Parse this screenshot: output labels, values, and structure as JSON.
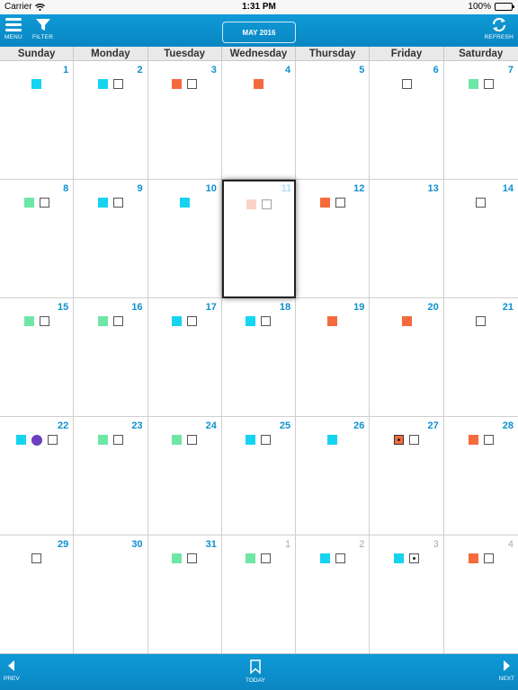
{
  "status_bar": {
    "carrier": "Carrier",
    "time": "1:31 PM",
    "battery": "100%"
  },
  "header": {
    "menu_label": "MENU",
    "filter_label": "FILTER",
    "month_label": "MAY 2016",
    "refresh_label": "REFRESH"
  },
  "weekdays": [
    "Sunday",
    "Monday",
    "Tuesday",
    "Wednesday",
    "Thursday",
    "Friday",
    "Saturday"
  ],
  "colors": {
    "cyan": "#16d4f0",
    "green": "#6ee6a6",
    "orange": "#f56a3d",
    "peach": "#f7b09a",
    "purple": "#6b3fc0",
    "accent": "#0d90cf"
  },
  "calendar": {
    "today_day": 11,
    "days": [
      {
        "day": "1",
        "month": "current",
        "marks": [
          "cyan"
        ]
      },
      {
        "day": "2",
        "month": "current",
        "marks": [
          "cyan",
          "box"
        ]
      },
      {
        "day": "3",
        "month": "current",
        "marks": [
          "orange",
          "box"
        ]
      },
      {
        "day": "4",
        "month": "current",
        "marks": [
          "orange"
        ]
      },
      {
        "day": "5",
        "month": "current",
        "marks": []
      },
      {
        "day": "6",
        "month": "current",
        "marks": [
          "box"
        ]
      },
      {
        "day": "7",
        "month": "current",
        "marks": [
          "green",
          "box"
        ]
      },
      {
        "day": "8",
        "month": "current",
        "marks": [
          "green",
          "box"
        ]
      },
      {
        "day": "9",
        "month": "current",
        "marks": [
          "cyan",
          "box"
        ]
      },
      {
        "day": "10",
        "month": "current",
        "marks": [
          "cyan"
        ]
      },
      {
        "day": "11",
        "month": "current",
        "marks": [
          "peach",
          "box"
        ],
        "today": true
      },
      {
        "day": "12",
        "month": "current",
        "marks": [
          "orange",
          "box"
        ]
      },
      {
        "day": "13",
        "month": "current",
        "marks": []
      },
      {
        "day": "14",
        "month": "current",
        "marks": [
          "box"
        ]
      },
      {
        "day": "15",
        "month": "current",
        "marks": [
          "green",
          "box"
        ]
      },
      {
        "day": "16",
        "month": "current",
        "marks": [
          "green",
          "box"
        ]
      },
      {
        "day": "17",
        "month": "current",
        "marks": [
          "cyan",
          "box"
        ]
      },
      {
        "day": "18",
        "month": "current",
        "marks": [
          "cyan",
          "box"
        ]
      },
      {
        "day": "19",
        "month": "current",
        "marks": [
          "orange"
        ]
      },
      {
        "day": "20",
        "month": "current",
        "marks": [
          "orange"
        ]
      },
      {
        "day": "21",
        "month": "current",
        "marks": [
          "box"
        ]
      },
      {
        "day": "22",
        "month": "current",
        "marks": [
          "cyan",
          "purple-circle",
          "box"
        ]
      },
      {
        "day": "23",
        "month": "current",
        "marks": [
          "green",
          "box"
        ]
      },
      {
        "day": "24",
        "month": "current",
        "marks": [
          "green",
          "box"
        ]
      },
      {
        "day": "25",
        "month": "current",
        "marks": [
          "cyan",
          "box"
        ]
      },
      {
        "day": "26",
        "month": "current",
        "marks": [
          "cyan"
        ]
      },
      {
        "day": "27",
        "month": "current",
        "marks": [
          "orange-dot",
          "box"
        ]
      },
      {
        "day": "28",
        "month": "current",
        "marks": [
          "orange",
          "box"
        ]
      },
      {
        "day": "29",
        "month": "current",
        "marks": [
          "box"
        ]
      },
      {
        "day": "30",
        "month": "current",
        "marks": []
      },
      {
        "day": "31",
        "month": "current",
        "marks": [
          "green",
          "box"
        ]
      },
      {
        "day": "1",
        "month": "next",
        "marks": [
          "green",
          "box"
        ]
      },
      {
        "day": "2",
        "month": "next",
        "marks": [
          "cyan",
          "box"
        ]
      },
      {
        "day": "3",
        "month": "next",
        "marks": [
          "cyan",
          "dotbox"
        ]
      },
      {
        "day": "4",
        "month": "next",
        "marks": [
          "orange",
          "box"
        ]
      }
    ]
  },
  "bottom_bar": {
    "prev_label": "PREV",
    "today_label": "TODAY",
    "next_label": "NEXT"
  }
}
